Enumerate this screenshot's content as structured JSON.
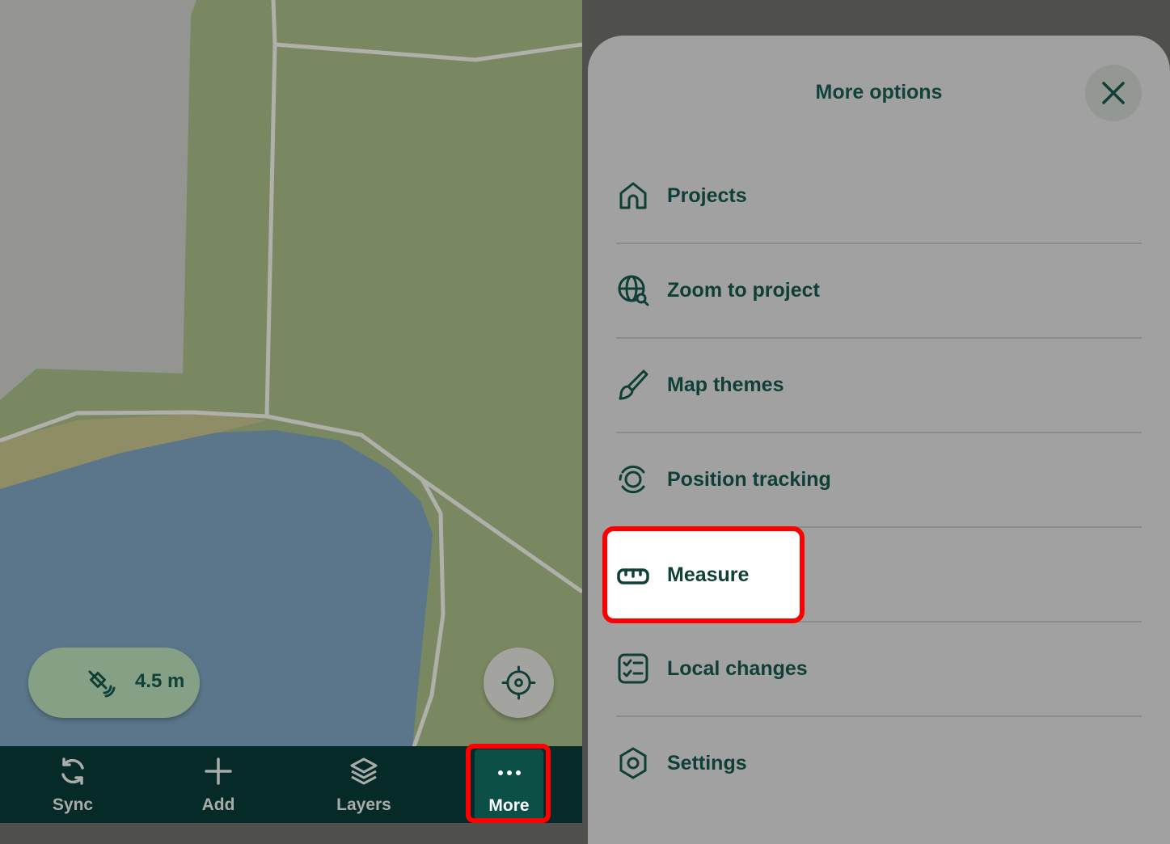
{
  "map": {
    "gps_accuracy": "4.5 m"
  },
  "bottom_nav": {
    "items": [
      {
        "label": "Sync",
        "icon": "sync-icon"
      },
      {
        "label": "Add",
        "icon": "plus-icon"
      },
      {
        "label": "Layers",
        "icon": "layers-icon"
      },
      {
        "label": "More",
        "icon": "more-dots-icon"
      }
    ]
  },
  "sheet": {
    "title": "More options",
    "items": [
      {
        "label": "Projects",
        "icon": "home-icon"
      },
      {
        "label": "Zoom to project",
        "icon": "globe-search-icon"
      },
      {
        "label": "Map themes",
        "icon": "brush-icon"
      },
      {
        "label": "Position tracking",
        "icon": "position-tracking-icon"
      },
      {
        "label": "Measure",
        "icon": "ruler-icon"
      },
      {
        "label": "Local changes",
        "icon": "checklist-icon"
      },
      {
        "label": "Settings",
        "icon": "settings-icon"
      }
    ]
  },
  "colors": {
    "nav_bg": "#052a27",
    "accent": "#0b4f47",
    "highlight": "#ff0000",
    "text_primary": "#0f3f37"
  }
}
